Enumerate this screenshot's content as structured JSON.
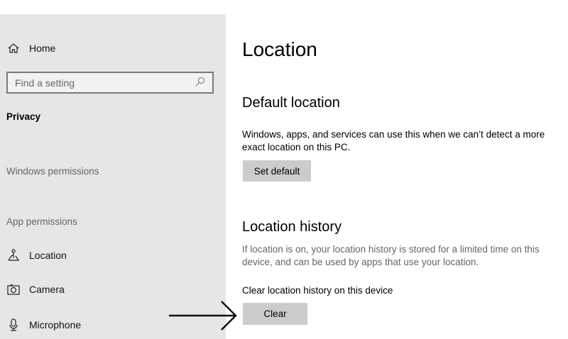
{
  "sidebar": {
    "home": "Home",
    "search_placeholder": "Find a setting",
    "section": "Privacy",
    "windows_permissions": "Windows permissions",
    "app_permissions": "App permissions",
    "items": [
      {
        "label": "Location",
        "icon": "location-icon"
      },
      {
        "label": "Camera",
        "icon": "camera-icon"
      },
      {
        "label": "Microphone",
        "icon": "microphone-icon"
      }
    ]
  },
  "main": {
    "title": "Location",
    "default_heading": "Default location",
    "default_text": "Windows, apps, and services can use this when we can’t detect a more exact location on this PC.",
    "set_default": "Set default",
    "history_heading": "Location history",
    "history_text": "If location is on, your location history is stored for a limited time on this device, and can be used by apps that use your location.",
    "clear_label": "Clear location history on this device",
    "clear_button": "Clear"
  }
}
